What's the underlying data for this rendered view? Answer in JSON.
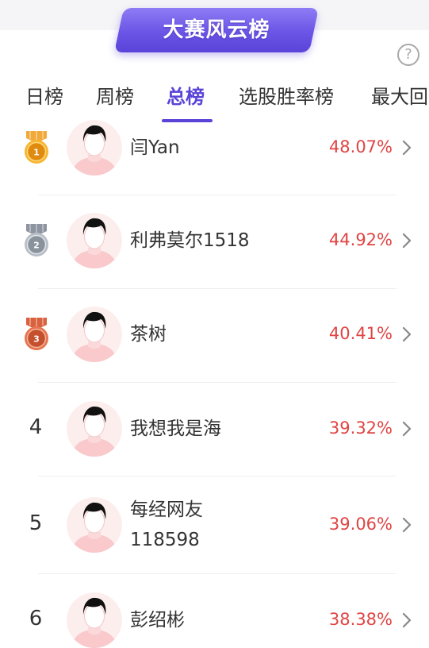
{
  "banner": {
    "title": "大赛风云榜"
  },
  "help": {
    "icon": "question-circle-icon",
    "symbol": "?"
  },
  "tabs": [
    {
      "label": "日榜",
      "active": false
    },
    {
      "label": "周榜",
      "active": false
    },
    {
      "label": "总榜",
      "active": true
    },
    {
      "label": "选股胜率榜",
      "active": false
    },
    {
      "label": "最大回"
    }
  ],
  "colors": {
    "accent": "#5a44d8",
    "percent": "#e04444",
    "gold": "#e59a1c",
    "silver": "#9ea4ac",
    "bronze": "#d2674a"
  },
  "entries": [
    {
      "rank": 1,
      "badge": "gold-medal-icon",
      "name_lines": [
        "闫Yan"
      ],
      "percent": "48.07%"
    },
    {
      "rank": 2,
      "badge": "silver-medal-icon",
      "name_lines": [
        "利弗莫尔1518"
      ],
      "percent": "44.92%"
    },
    {
      "rank": 3,
      "badge": "bronze-medal-icon",
      "name_lines": [
        "茶树"
      ],
      "percent": "40.41%"
    },
    {
      "rank": "4",
      "name_lines": [
        "我想我是海"
      ],
      "percent": "39.32%"
    },
    {
      "rank": "5",
      "name_lines": [
        "每经网友",
        "118598"
      ],
      "percent": "39.06%"
    },
    {
      "rank": "6",
      "name_lines": [
        "彭绍彬"
      ],
      "percent": "38.38%"
    }
  ]
}
